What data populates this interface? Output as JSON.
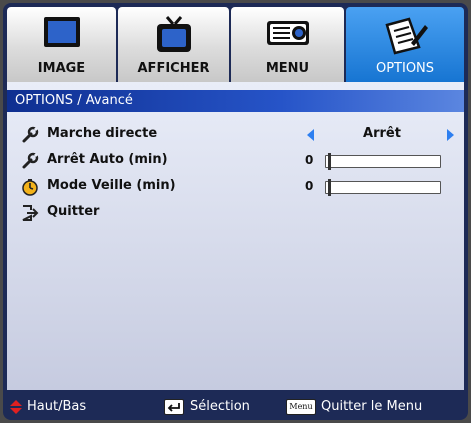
{
  "tabs": [
    {
      "label": "IMAGE",
      "icon": "monitor-icon",
      "active": false
    },
    {
      "label": "AFFICHER",
      "icon": "tv-icon",
      "active": false
    },
    {
      "label": "MENU",
      "icon": "projector-icon",
      "active": false
    },
    {
      "label": "OPTIONS",
      "icon": "notepad-pen-icon",
      "active": true
    }
  ],
  "panel": {
    "title": "OPTIONS / Avancé",
    "rows": [
      {
        "label": "Marche directe",
        "icon": "wrench-icon",
        "value": "Arrêt"
      },
      {
        "label": "Arrêt Auto (min)",
        "icon": "wrench-icon",
        "number": "0",
        "slider_fraction": 0
      },
      {
        "label": "Mode Veille (min)",
        "icon": "clock-icon",
        "number": "0",
        "slider_fraction": 0
      },
      {
        "label": "Quitter",
        "icon": "exit-icon"
      }
    ]
  },
  "footer": {
    "nav": "Haut/Bas",
    "select": "Sélection",
    "menu_key": "Menu",
    "exit": "Quitter le Menu"
  },
  "colors": {
    "accent": "#1775d2",
    "frame": "#1d2a56",
    "title_bar": "#2654c8",
    "arrow": "#2d7ff0",
    "nav_icon": "#e02020"
  }
}
